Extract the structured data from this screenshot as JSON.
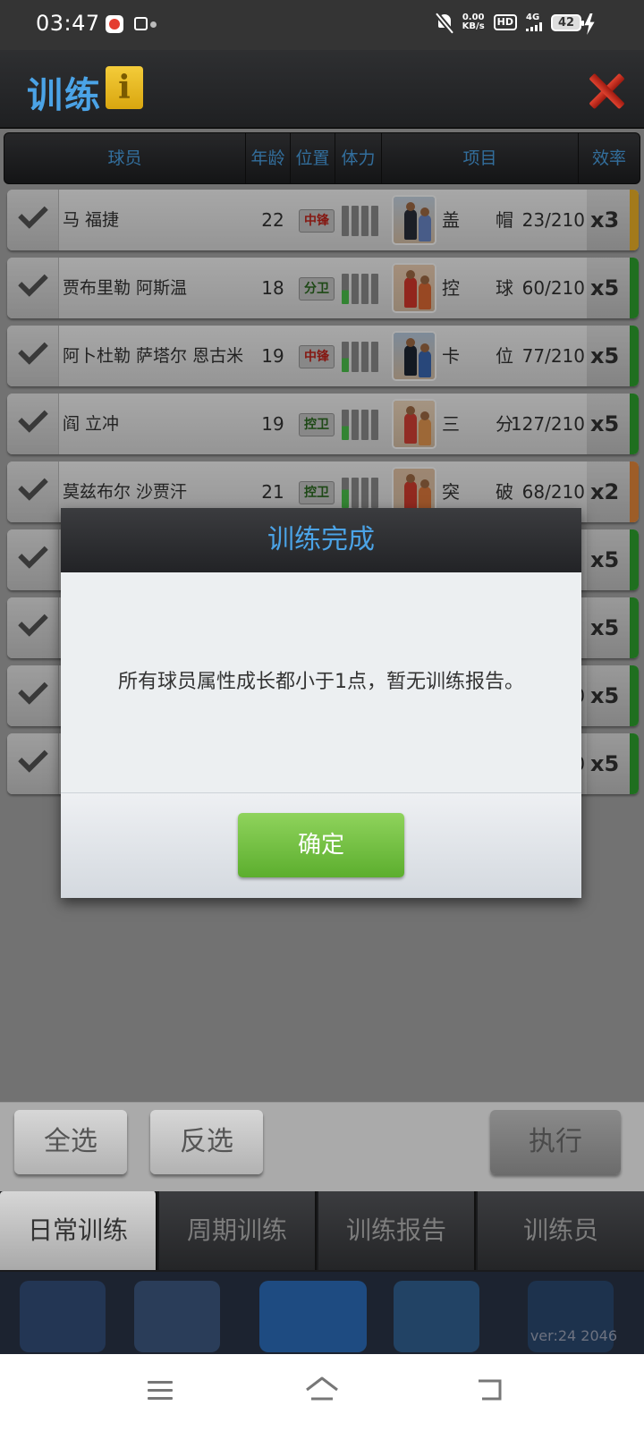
{
  "status_bar": {
    "time": "03:47",
    "net_speed": "0.00",
    "net_unit": "KB/s",
    "hd": "HD",
    "signal": "4G",
    "battery": "42"
  },
  "title": "训练",
  "table": {
    "headers": [
      "球员",
      "年龄",
      "位置",
      "体力",
      "项目",
      "效率"
    ],
    "rows": [
      {
        "name": "马 福捷",
        "age": "22",
        "pos": "中锋",
        "pos_color": "red",
        "proj_a": "盖",
        "proj_b": "帽",
        "progress": "23/210",
        "eff": "x3",
        "eff_color": "#f0b428"
      },
      {
        "name": "贾布里勒 阿斯温",
        "age": "18",
        "pos": "分卫",
        "pos_color": "green",
        "proj_a": "控",
        "proj_b": "球",
        "progress": "60/210",
        "eff": "x5",
        "eff_color": "#2fa42f"
      },
      {
        "name": "阿卜杜勒 萨塔尔 恩古米",
        "age": "19",
        "pos": "中锋",
        "pos_color": "red",
        "proj_a": "卡",
        "proj_b": "位",
        "progress": "77/210",
        "eff": "x5",
        "eff_color": "#2fa42f"
      },
      {
        "name": "阎 立冲",
        "age": "19",
        "pos": "控卫",
        "pos_color": "green",
        "proj_a": "三",
        "proj_b": "分",
        "progress": "127/210",
        "eff": "x5",
        "eff_color": "#2fa42f"
      },
      {
        "name": "莫兹布尔 沙贾汗",
        "age": "21",
        "pos": "控卫",
        "pos_color": "green",
        "proj_a": "突",
        "proj_b": "破",
        "progress": "68/210",
        "eff": "x2",
        "eff_color": "#e88a3c"
      },
      {
        "name": "",
        "age": "",
        "pos": "",
        "pos_color": "green",
        "proj_a": "",
        "proj_b": "",
        "progress": "",
        "eff": "x5",
        "eff_color": "#2fa42f"
      },
      {
        "name": "",
        "age": "",
        "pos": "",
        "pos_color": "green",
        "proj_a": "",
        "proj_b": "",
        "progress": "",
        "eff": "x5",
        "eff_color": "#2fa42f"
      },
      {
        "name": "",
        "age": "",
        "pos": "",
        "pos_color": "green",
        "proj_a": "",
        "proj_b": "",
        "progress": "0",
        "eff": "x5",
        "eff_color": "#2fa42f"
      },
      {
        "name": "",
        "age": "",
        "pos": "",
        "pos_color": "green",
        "proj_a": "",
        "proj_b": "",
        "progress": "0",
        "eff": "x5",
        "eff_color": "#2fa42f"
      }
    ]
  },
  "dialog": {
    "title": "训练完成",
    "message": "所有球员属性成长都小于1点，暂无训练报告。",
    "ok": "确定"
  },
  "actions": {
    "select_all": "全选",
    "invert": "反选",
    "execute": "执行"
  },
  "tabs": [
    "日常训练",
    "周期训练",
    "训练报告",
    "训练员"
  ],
  "version": "ver:24  2046",
  "accent_color": "#4ba3e6"
}
